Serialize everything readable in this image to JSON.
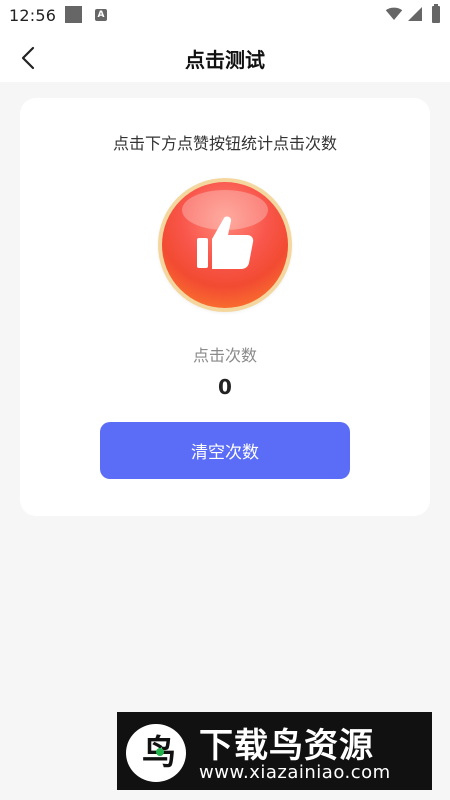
{
  "status_bar": {
    "time": "12:56",
    "icons": [
      "square-icon",
      "a-icon",
      "wifi-icon",
      "signal-icon",
      "battery-icon"
    ]
  },
  "nav": {
    "back_icon": "chevron-left-icon",
    "title": "点击测试"
  },
  "card": {
    "instruction": "点击下方点赞按钮统计点击次数",
    "like_icon": "thumbs-up-icon",
    "count_label": "点击次数",
    "count_value": "0",
    "clear_button": "清空次数"
  },
  "colors": {
    "page_bg": "#f6f6f6",
    "card_bg": "#ffffff",
    "accent": "#5b6cf6",
    "like_ring": "#f4d79e",
    "like_red": "#f24b32"
  },
  "watermark": {
    "title": "下载鸟资源",
    "url": "www.xiazainiao.com",
    "logo_glyph": "鸟"
  }
}
